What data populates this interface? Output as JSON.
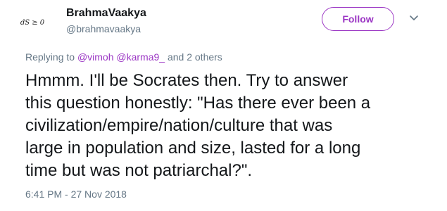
{
  "author": {
    "avatar_text": "dS ≥ 0",
    "display_name": "BrahmaVaakya",
    "handle": "@brahmavaakya"
  },
  "actions": {
    "follow_label": "Follow",
    "more_icon": "chevron-down-icon"
  },
  "reply_context": {
    "prefix": "Replying to ",
    "mention_1": "@vimoh",
    "mention_2": "@karma9_",
    "suffix": " and 2 others"
  },
  "tweet": {
    "text": "Hmmm. I'll be Socrates then. Try to answer\nthis question honestly: \"Has there ever been a\ncivilization/empire/nation/culture that was\nlarge in population and size, lasted for a long\ntime but was not patriarchal?\".",
    "timestamp": "6:41 PM - 27 Nov 2018"
  },
  "colors": {
    "accent": "#9b36c4",
    "text": "#14171a",
    "muted": "#657786"
  }
}
